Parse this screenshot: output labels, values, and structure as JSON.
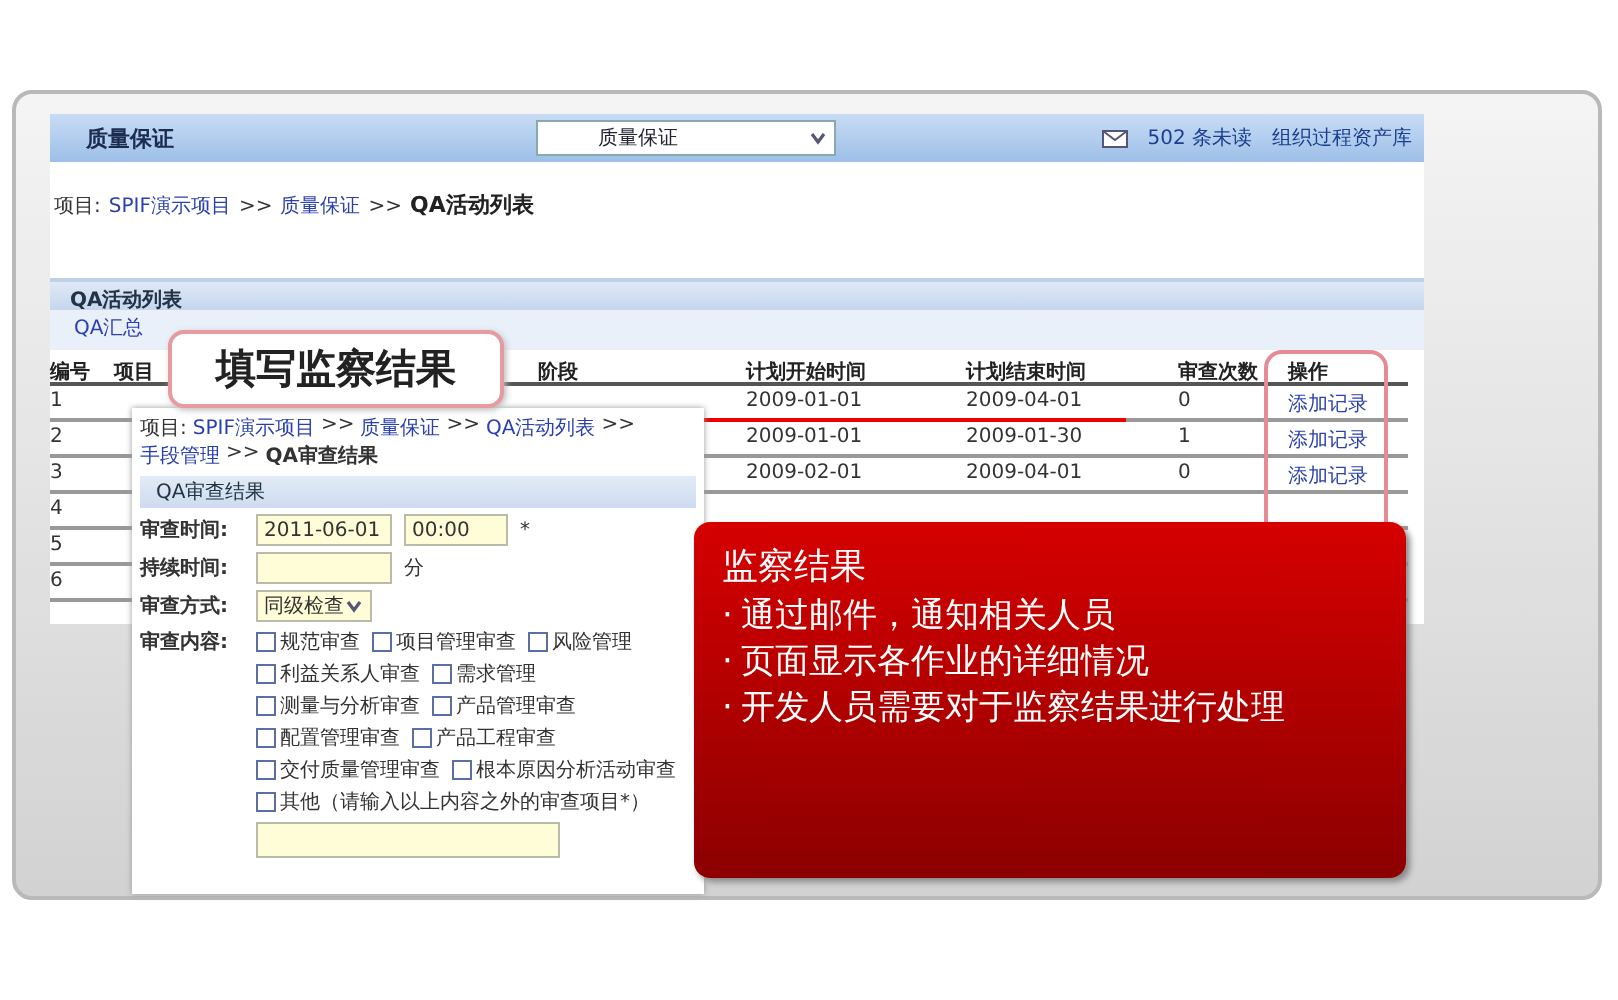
{
  "app_header": {
    "title": "质量保证",
    "module_select": {
      "value": "质量保证"
    },
    "mail": "502 条未读",
    "link": "组织过程资产库"
  },
  "breadcrumb": [
    {
      "text": "项目:",
      "kind": "label"
    },
    {
      "text": "SPIF演示项目",
      "kind": "link"
    },
    {
      "text": ">>",
      "kind": "separator"
    },
    {
      "text": "质量保证",
      "kind": "link"
    },
    {
      "text": ">>",
      "kind": "separator"
    },
    {
      "text": "QA活动列表",
      "kind": "current"
    }
  ],
  "panel": {
    "title": "QA活动列表",
    "subtitle": "QA汇总"
  },
  "table": {
    "columns": [
      "编号",
      "项目",
      "阶段",
      "计划开始时间",
      "计划结束时间",
      "审查次数",
      "操作"
    ],
    "rows": [
      {
        "no": "1",
        "start": "2009-01-01",
        "end": "2009-04-01",
        "count": "0",
        "action": "添加记录"
      },
      {
        "no": "2",
        "start": "2009-01-01",
        "end": "2009-01-30",
        "count": "1",
        "action": "添加记录"
      },
      {
        "no": "3",
        "start": "2009-02-01",
        "end": "2009-04-01",
        "count": "0",
        "action": "添加记录"
      },
      {
        "no": "4"
      },
      {
        "no": "5"
      },
      {
        "no": "6"
      }
    ]
  },
  "callout": "填写监察结果",
  "form_popup": {
    "breadcrumb": [
      {
        "text": "项目:",
        "kind": "label"
      },
      {
        "text": "SPIF演示项目",
        "kind": "link"
      },
      {
        "text": ">>",
        "kind": "separator"
      },
      {
        "text": "质量保证",
        "kind": "link"
      },
      {
        "text": ">>",
        "kind": "separator"
      },
      {
        "text": "QA活动列表",
        "kind": "link"
      },
      {
        "text": ">>",
        "kind": "separator"
      },
      {
        "text": "手段管理",
        "kind": "link"
      },
      {
        "text": ">>",
        "kind": "separator"
      },
      {
        "text": "QA审查结果",
        "kind": "current"
      }
    ],
    "title": "QA审查结果",
    "review_time": {
      "label": "审查时间:",
      "date": "2011-06-01",
      "time": "00:00",
      "required": "*"
    },
    "duration": {
      "label": "持续时间:",
      "unit": "分"
    },
    "method": {
      "label": "审查方式:",
      "value": "同级检查"
    },
    "content": {
      "label": "审查内容:",
      "options": [
        {
          "label": "规范审查",
          "checked": false
        },
        {
          "label": "项目管理审查",
          "checked": false
        },
        {
          "label": "风险管理",
          "checked": false
        },
        {
          "label": "利益关系人审查",
          "checked": false
        },
        {
          "label": "需求管理",
          "checked": false
        },
        {
          "label": "测量与分析审查",
          "checked": false
        },
        {
          "label": "产品管理审查",
          "checked": false
        },
        {
          "label": "配置管理审查",
          "checked": false
        },
        {
          "label": "产品工程审查",
          "checked": false
        },
        {
          "label": "交付质量管理审查",
          "checked": false
        },
        {
          "label": "根本原因分析活动审查",
          "checked": false
        },
        {
          "label": "其他（请输入以上内容之外的审查项目*）",
          "checked": false
        }
      ]
    }
  },
  "note_box": {
    "title": "监察结果",
    "bullets": [
      {
        "bullet": "·",
        "text": "通过邮件，通知相关人员"
      },
      {
        "bullet": "·",
        "text": "页面显示各作业的详细情况"
      },
      {
        "bullet": "·",
        "text": "开发人员需要对于监察结果进行处理"
      }
    ]
  }
}
